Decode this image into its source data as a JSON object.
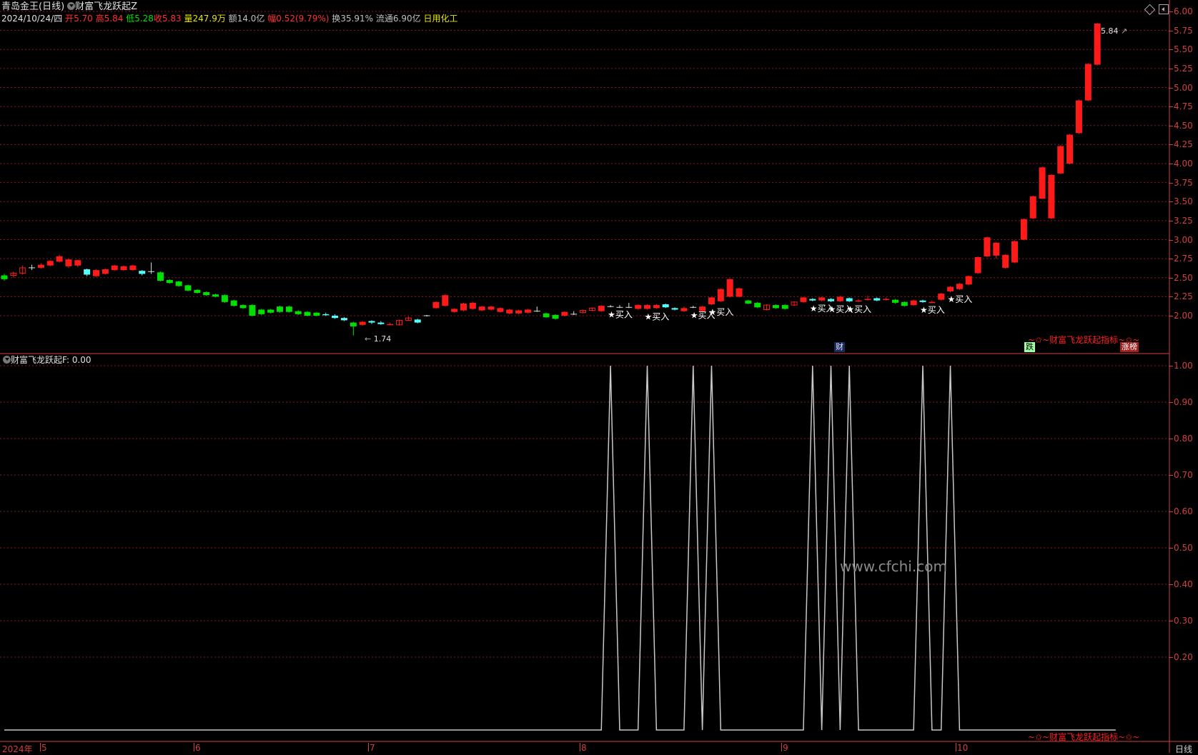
{
  "header": {
    "stock_name": "青岛金王",
    "period": "(日线)",
    "indicator_main": "财富飞龙跃起Z",
    "date": "2024/10/24/四",
    "open_label": "开",
    "open": "5.70",
    "high_label": "高",
    "high": "5.84",
    "low_label": "低",
    "low": "5.28",
    "close_label": "收",
    "close": "5.83",
    "vol_label": "量",
    "vol": "247.9万",
    "amt_label": "额",
    "amt": "14.0亿",
    "chg_label": "幅",
    "chg": "0.52(9.79%)",
    "turn_label": "换",
    "turn": "35.91%",
    "float_label": "流通",
    "float": "6.90亿",
    "sector": "日用化工"
  },
  "sub_header": {
    "indicator_name": "财富飞龙跃起F",
    "value": ": 0.00"
  },
  "annotations": {
    "high_mark": "5.84",
    "low_mark": "1.74",
    "buy_label": "★买入",
    "banner_top": "~✩~财富飞龙跃起指标~✩~",
    "banner_bottom": "~✩~财富飞龙跃起指标~✩~",
    "tag_cai": "财",
    "tag_die": "跌",
    "tag_zhangting": "涨榜"
  },
  "watermark": "www.cfchi.com",
  "price_axis": {
    "labels": [
      "6.00",
      "5.75",
      "5.50",
      "5.25",
      "5.00",
      "4.75",
      "4.50",
      "4.25",
      "4.00",
      "3.75",
      "3.50",
      "3.25",
      "3.00",
      "2.75",
      "2.50",
      "2.25",
      "2.00"
    ],
    "values": [
      6.0,
      5.75,
      5.5,
      5.25,
      5.0,
      4.75,
      4.5,
      4.25,
      4.0,
      3.75,
      3.5,
      3.25,
      3.0,
      2.75,
      2.5,
      2.25,
      2.0
    ]
  },
  "sub_axis": {
    "labels": [
      "1.00",
      "0.90",
      "0.80",
      "0.70",
      "0.60",
      "0.50",
      "0.40",
      "0.30",
      "0.20"
    ],
    "values": [
      1.0,
      0.9,
      0.8,
      0.7,
      0.6,
      0.5,
      0.4,
      0.3,
      0.2
    ]
  },
  "time_axis": {
    "year_label": "2024年",
    "months": [
      {
        "label": "5",
        "index": 0
      },
      {
        "label": "6",
        "index": 21
      },
      {
        "label": "7",
        "index": 40
      },
      {
        "label": "8",
        "index": 63
      },
      {
        "label": "9",
        "index": 85
      },
      {
        "label": "10",
        "index": 104
      }
    ],
    "period_button": "日线"
  },
  "colors": {
    "up": "#ff1a1a",
    "down_green": "#00e000",
    "down_cyan": "#54ffff",
    "grid": "#8a1a1a",
    "axis": "#d04040",
    "line": "#c8c8c8"
  },
  "chart_data": {
    "type": "candlestick",
    "title": "财富飞龙跃起Z",
    "ylim": [
      1.74,
      5.84
    ],
    "candles": [
      {
        "o": 2.48,
        "c": 2.53,
        "h": 2.55,
        "l": 2.46,
        "t": "g"
      },
      {
        "o": 2.53,
        "c": 2.56,
        "h": 2.58,
        "l": 2.5,
        "t": "h"
      },
      {
        "o": 2.56,
        "c": 2.63,
        "h": 2.66,
        "l": 2.54,
        "t": "h"
      },
      {
        "o": 2.63,
        "c": 2.63,
        "h": 2.67,
        "l": 2.6,
        "t": "c"
      },
      {
        "o": 2.63,
        "c": 2.67,
        "h": 2.69,
        "l": 2.62,
        "t": "r"
      },
      {
        "o": 2.66,
        "c": 2.72,
        "h": 2.73,
        "l": 2.65,
        "t": "r"
      },
      {
        "o": 2.71,
        "c": 2.78,
        "h": 2.8,
        "l": 2.7,
        "t": "r"
      },
      {
        "o": 2.74,
        "c": 2.65,
        "h": 2.75,
        "l": 2.63,
        "t": "r"
      },
      {
        "o": 2.73,
        "c": 2.66,
        "h": 2.74,
        "l": 2.64,
        "t": "r"
      },
      {
        "o": 2.61,
        "c": 2.54,
        "h": 2.62,
        "l": 2.52,
        "t": "cy"
      },
      {
        "o": 2.6,
        "c": 2.52,
        "h": 2.61,
        "l": 2.51,
        "t": "r"
      },
      {
        "o": 2.55,
        "c": 2.61,
        "h": 2.62,
        "l": 2.54,
        "t": "r"
      },
      {
        "o": 2.6,
        "c": 2.66,
        "h": 2.67,
        "l": 2.59,
        "t": "r"
      },
      {
        "o": 2.6,
        "c": 2.65,
        "h": 2.66,
        "l": 2.59,
        "t": "r"
      },
      {
        "o": 2.6,
        "c": 2.66,
        "h": 2.67,
        "l": 2.59,
        "t": "r"
      },
      {
        "o": 2.59,
        "c": 2.55,
        "h": 2.6,
        "l": 2.53,
        "t": "cy"
      },
      {
        "o": 2.58,
        "c": 2.58,
        "h": 2.7,
        "l": 2.55,
        "t": "c"
      },
      {
        "o": 2.57,
        "c": 2.46,
        "h": 2.58,
        "l": 2.45,
        "t": "g"
      },
      {
        "o": 2.47,
        "c": 2.43,
        "h": 2.48,
        "l": 2.42,
        "t": "g"
      },
      {
        "o": 2.45,
        "c": 2.39,
        "h": 2.46,
        "l": 2.38,
        "t": "g"
      },
      {
        "o": 2.4,
        "c": 2.33,
        "h": 2.41,
        "l": 2.32,
        "t": "g"
      },
      {
        "o": 2.34,
        "c": 2.3,
        "h": 2.35,
        "l": 2.29,
        "t": "g"
      },
      {
        "o": 2.31,
        "c": 2.27,
        "h": 2.32,
        "l": 2.26,
        "t": "g"
      },
      {
        "o": 2.28,
        "c": 2.25,
        "h": 2.29,
        "l": 2.24,
        "t": "g"
      },
      {
        "o": 2.27,
        "c": 2.18,
        "h": 2.28,
        "l": 2.17,
        "t": "g"
      },
      {
        "o": 2.2,
        "c": 2.13,
        "h": 2.21,
        "l": 2.12,
        "t": "g"
      },
      {
        "o": 2.14,
        "c": 2.1,
        "h": 2.15,
        "l": 2.09,
        "t": "g"
      },
      {
        "o": 2.14,
        "c": 2.0,
        "h": 2.15,
        "l": 1.99,
        "t": "g"
      },
      {
        "o": 2.08,
        "c": 2.02,
        "h": 2.09,
        "l": 2.01,
        "t": "g"
      },
      {
        "o": 2.08,
        "c": 2.04,
        "h": 2.09,
        "l": 2.03,
        "t": "g"
      },
      {
        "o": 2.12,
        "c": 2.05,
        "h": 2.13,
        "l": 2.04,
        "t": "g"
      },
      {
        "o": 2.12,
        "c": 2.05,
        "h": 2.13,
        "l": 2.04,
        "t": "g"
      },
      {
        "o": 2.06,
        "c": 2.02,
        "h": 2.07,
        "l": 2.01,
        "t": "g"
      },
      {
        "o": 2.05,
        "c": 2.0,
        "h": 2.06,
        "l": 1.99,
        "t": "g"
      },
      {
        "o": 2.04,
        "c": 2.0,
        "h": 2.05,
        "l": 1.99,
        "t": "g"
      },
      {
        "o": 2.02,
        "c": 2.02,
        "h": 2.04,
        "l": 2.0,
        "t": "cy"
      },
      {
        "o": 2.0,
        "c": 1.97,
        "h": 2.02,
        "l": 1.96,
        "t": "cy"
      },
      {
        "o": 1.97,
        "c": 1.94,
        "h": 1.98,
        "l": 1.93,
        "t": "cy"
      },
      {
        "o": 1.91,
        "c": 1.86,
        "h": 1.92,
        "l": 1.74,
        "t": "g"
      },
      {
        "o": 1.88,
        "c": 1.92,
        "h": 1.93,
        "l": 1.87,
        "t": "r"
      },
      {
        "o": 1.91,
        "c": 1.93,
        "h": 1.94,
        "l": 1.89,
        "t": "cy"
      },
      {
        "o": 1.91,
        "c": 1.89,
        "h": 1.93,
        "l": 1.88,
        "t": "cy"
      },
      {
        "o": 1.89,
        "c": 1.89,
        "h": 1.91,
        "l": 1.88,
        "t": "r"
      },
      {
        "o": 1.88,
        "c": 1.94,
        "h": 1.95,
        "l": 1.87,
        "t": "h"
      },
      {
        "o": 1.94,
        "c": 1.97,
        "h": 1.99,
        "l": 1.93,
        "t": "h"
      },
      {
        "o": 1.95,
        "c": 1.91,
        "h": 1.96,
        "l": 1.9,
        "t": "cy"
      },
      {
        "o": 2.0,
        "c": 2.0,
        "h": 2.01,
        "l": 1.99,
        "t": "c"
      },
      {
        "o": 2.1,
        "c": 2.18,
        "h": 2.19,
        "l": 2.09,
        "t": "r"
      },
      {
        "o": 2.13,
        "c": 2.27,
        "h": 2.28,
        "l": 2.12,
        "t": "r"
      },
      {
        "o": 2.09,
        "c": 2.05,
        "h": 2.1,
        "l": 2.04,
        "t": "r"
      },
      {
        "o": 2.07,
        "c": 2.16,
        "h": 2.17,
        "l": 2.06,
        "t": "r"
      },
      {
        "o": 2.09,
        "c": 2.17,
        "h": 2.18,
        "l": 2.08,
        "t": "r"
      },
      {
        "o": 2.07,
        "c": 2.12,
        "h": 2.13,
        "l": 2.06,
        "t": "r"
      },
      {
        "o": 2.08,
        "c": 2.12,
        "h": 2.13,
        "l": 2.07,
        "t": "r"
      },
      {
        "o": 2.05,
        "c": 2.1,
        "h": 2.11,
        "l": 2.04,
        "t": "r"
      },
      {
        "o": 2.03,
        "c": 2.08,
        "h": 2.09,
        "l": 2.02,
        "t": "r"
      },
      {
        "o": 2.03,
        "c": 2.07,
        "h": 2.08,
        "l": 2.02,
        "t": "r"
      },
      {
        "o": 2.04,
        "c": 2.08,
        "h": 2.09,
        "l": 2.03,
        "t": "r"
      },
      {
        "o": 2.06,
        "c": 2.06,
        "h": 2.12,
        "l": 2.05,
        "t": "c"
      },
      {
        "o": 2.03,
        "c": 1.98,
        "h": 2.04,
        "l": 1.97,
        "t": "g"
      },
      {
        "o": 2.01,
        "c": 1.96,
        "h": 2.02,
        "l": 1.95,
        "t": "g"
      },
      {
        "o": 2.0,
        "c": 2.05,
        "h": 2.06,
        "l": 1.99,
        "t": "r"
      },
      {
        "o": 2.02,
        "c": 2.02,
        "h": 2.06,
        "l": 2.01,
        "t": "c"
      },
      {
        "o": 2.04,
        "c": 2.07,
        "h": 2.08,
        "l": 2.03,
        "t": "h"
      },
      {
        "o": 2.07,
        "c": 2.1,
        "h": 2.11,
        "l": 2.06,
        "t": "h"
      },
      {
        "o": 2.06,
        "c": 2.13,
        "h": 2.14,
        "l": 2.05,
        "t": "r"
      },
      {
        "o": 2.12,
        "c": 2.12,
        "h": 2.14,
        "l": 2.11,
        "t": "c"
      },
      {
        "o": 2.11,
        "c": 2.11,
        "h": 2.14,
        "l": 2.1,
        "t": "c"
      },
      {
        "o": 2.11,
        "c": 2.11,
        "h": 2.17,
        "l": 2.1,
        "t": "c"
      },
      {
        "o": 2.09,
        "c": 2.14,
        "h": 2.15,
        "l": 2.08,
        "t": "r"
      },
      {
        "o": 2.09,
        "c": 2.14,
        "h": 2.15,
        "l": 2.08,
        "t": "r"
      },
      {
        "o": 2.1,
        "c": 2.14,
        "h": 2.15,
        "l": 2.09,
        "t": "r"
      },
      {
        "o": 2.11,
        "c": 2.15,
        "h": 2.16,
        "l": 2.1,
        "t": "cy"
      },
      {
        "o": 2.1,
        "c": 2.08,
        "h": 2.11,
        "l": 2.07,
        "t": "cy"
      },
      {
        "o": 2.06,
        "c": 2.1,
        "h": 2.12,
        "l": 2.05,
        "t": "r"
      },
      {
        "o": 2.11,
        "c": 2.11,
        "h": 2.13,
        "l": 2.1,
        "t": "c"
      },
      {
        "o": 2.06,
        "c": 2.12,
        "h": 2.13,
        "l": 2.05,
        "t": "r"
      },
      {
        "o": 2.15,
        "c": 2.24,
        "h": 2.25,
        "l": 2.14,
        "t": "r"
      },
      {
        "o": 2.19,
        "c": 2.35,
        "h": 2.36,
        "l": 2.18,
        "t": "r"
      },
      {
        "o": 2.25,
        "c": 2.48,
        "h": 2.49,
        "l": 2.24,
        "t": "r"
      },
      {
        "o": 2.36,
        "c": 2.25,
        "h": 2.37,
        "l": 2.24,
        "t": "r"
      },
      {
        "o": 2.2,
        "c": 2.16,
        "h": 2.21,
        "l": 2.15,
        "t": "g"
      },
      {
        "o": 2.17,
        "c": 2.11,
        "h": 2.18,
        "l": 2.1,
        "t": "g"
      },
      {
        "o": 2.08,
        "c": 2.14,
        "h": 2.15,
        "l": 2.07,
        "t": "h"
      },
      {
        "o": 2.14,
        "c": 2.1,
        "h": 2.15,
        "l": 2.09,
        "t": "g"
      },
      {
        "o": 2.14,
        "c": 2.09,
        "h": 2.15,
        "l": 2.08,
        "t": "g"
      },
      {
        "o": 2.14,
        "c": 2.18,
        "h": 2.19,
        "l": 2.13,
        "t": "h"
      },
      {
        "o": 2.18,
        "c": 2.24,
        "h": 2.25,
        "l": 2.17,
        "t": "r"
      },
      {
        "o": 2.2,
        "c": 2.22,
        "h": 2.23,
        "l": 2.19,
        "t": "cy"
      },
      {
        "o": 2.2,
        "c": 2.24,
        "h": 2.25,
        "l": 2.19,
        "t": "r"
      },
      {
        "o": 2.22,
        "c": 2.19,
        "h": 2.23,
        "l": 2.18,
        "t": "cy"
      },
      {
        "o": 2.19,
        "c": 2.25,
        "h": 2.26,
        "l": 2.18,
        "t": "r"
      },
      {
        "o": 2.23,
        "c": 2.19,
        "h": 2.24,
        "l": 2.18,
        "t": "cy"
      },
      {
        "o": 2.2,
        "c": 2.2,
        "h": 2.22,
        "l": 2.18,
        "t": "r"
      },
      {
        "o": 2.22,
        "c": 2.22,
        "h": 2.26,
        "l": 2.2,
        "t": "r"
      },
      {
        "o": 2.23,
        "c": 2.2,
        "h": 2.24,
        "l": 2.19,
        "t": "cy"
      },
      {
        "o": 2.22,
        "c": 2.22,
        "h": 2.24,
        "l": 2.2,
        "t": "r"
      },
      {
        "o": 2.21,
        "c": 2.17,
        "h": 2.22,
        "l": 2.16,
        "t": "g"
      },
      {
        "o": 2.18,
        "c": 2.13,
        "h": 2.19,
        "l": 2.12,
        "t": "g"
      },
      {
        "o": 2.14,
        "c": 2.2,
        "h": 2.21,
        "l": 2.13,
        "t": "r"
      },
      {
        "o": 2.2,
        "c": 2.18,
        "h": 2.21,
        "l": 2.17,
        "t": "cy"
      },
      {
        "o": 2.18,
        "c": 2.18,
        "h": 2.2,
        "l": 2.17,
        "t": "r"
      },
      {
        "o": 2.21,
        "c": 2.29,
        "h": 2.3,
        "l": 2.2,
        "t": "r"
      },
      {
        "o": 2.32,
        "c": 2.38,
        "h": 2.39,
        "l": 2.31,
        "t": "r"
      },
      {
        "o": 2.35,
        "c": 2.42,
        "h": 2.43,
        "l": 2.34,
        "t": "r"
      },
      {
        "o": 2.41,
        "c": 2.52,
        "h": 2.53,
        "l": 2.4,
        "t": "r"
      },
      {
        "o": 2.56,
        "c": 2.77,
        "h": 2.78,
        "l": 2.55,
        "t": "r"
      },
      {
        "o": 2.78,
        "c": 3.03,
        "h": 3.04,
        "l": 2.77,
        "t": "r"
      },
      {
        "o": 2.79,
        "c": 2.96,
        "h": 2.97,
        "l": 2.75,
        "t": "r"
      },
      {
        "o": 2.63,
        "c": 2.8,
        "h": 2.81,
        "l": 2.62,
        "t": "r"
      },
      {
        "o": 2.7,
        "c": 2.98,
        "h": 2.99,
        "l": 2.69,
        "t": "r"
      },
      {
        "o": 3.0,
        "c": 3.27,
        "h": 3.28,
        "l": 2.99,
        "t": "r"
      },
      {
        "o": 3.28,
        "c": 3.57,
        "h": 3.58,
        "l": 3.27,
        "t": "r"
      },
      {
        "o": 3.54,
        "c": 3.95,
        "h": 3.96,
        "l": 3.53,
        "t": "r"
      },
      {
        "o": 3.28,
        "c": 3.85,
        "h": 3.86,
        "l": 3.27,
        "t": "r"
      },
      {
        "o": 3.87,
        "c": 4.23,
        "h": 4.24,
        "l": 3.86,
        "t": "r"
      },
      {
        "o": 4.0,
        "c": 4.38,
        "h": 4.39,
        "l": 3.99,
        "t": "r"
      },
      {
        "o": 4.4,
        "c": 4.83,
        "h": 4.84,
        "l": 4.39,
        "t": "r"
      },
      {
        "o": 4.83,
        "c": 5.31,
        "h": 5.32,
        "l": 4.82,
        "t": "r"
      },
      {
        "o": 5.3,
        "c": 5.84,
        "h": 5.85,
        "l": 5.29,
        "t": "r"
      }
    ],
    "buy_signals": [
      66,
      70,
      75,
      77,
      88,
      90,
      92,
      100,
      103
    ],
    "sub_indicator": {
      "name": "财富飞龙跃起F",
      "ylim": [
        0,
        1.0
      ],
      "signals": [
        66,
        70,
        75,
        77,
        88,
        90,
        92,
        100,
        103
      ],
      "start_index": 0,
      "end_index": 121
    }
  }
}
